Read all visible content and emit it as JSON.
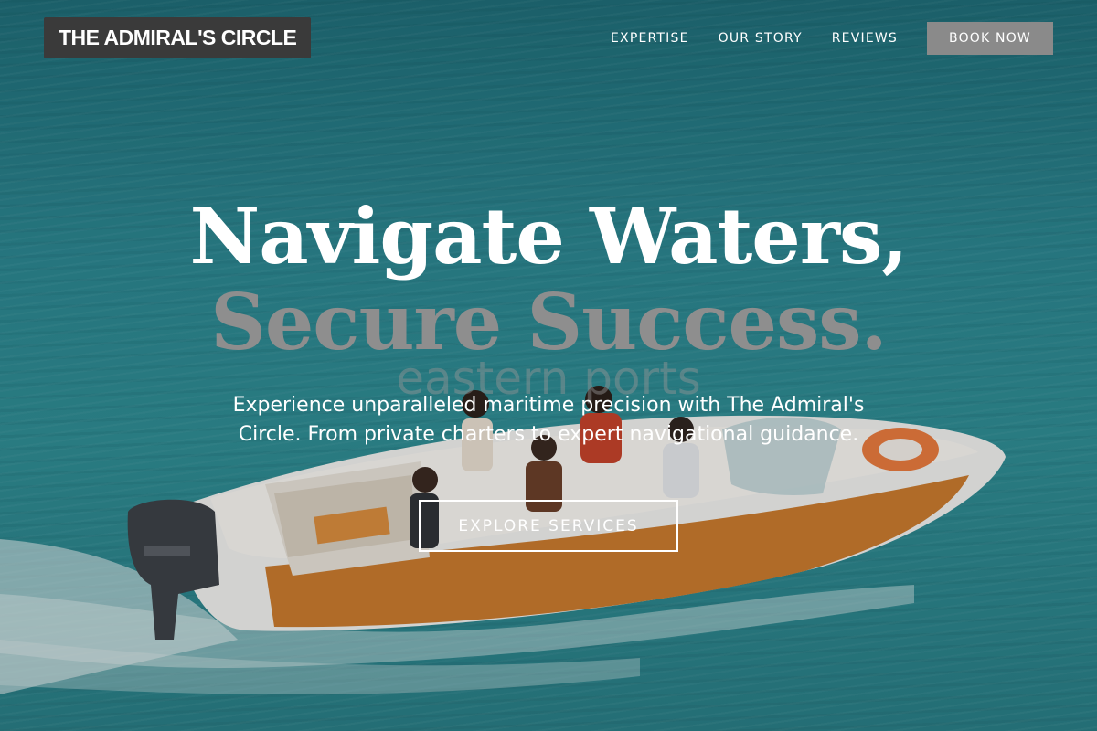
{
  "header": {
    "logo_text": "THE ADMIRAL'S CIRCLE",
    "nav": [
      {
        "label": "EXPERTISE"
      },
      {
        "label": "OUR STORY"
      },
      {
        "label": "REVIEWS"
      }
    ],
    "book_button": "BOOK NOW"
  },
  "hero": {
    "headline_line1": "Navigate Waters,",
    "headline_line2": "Secure Success.",
    "ghost_text": "eastern ports",
    "subtitle": "Experience unparalleled maritime precision with The Admiral's Circle. From private charters to expert navigational guidance.",
    "cta": "EXPLORE SERVICES"
  },
  "colors": {
    "water": "#2f8c93",
    "logo_bg": "#3a3a3a",
    "book_bg": "#8a8a8a",
    "headline_secondary": "#8e8e8e"
  }
}
